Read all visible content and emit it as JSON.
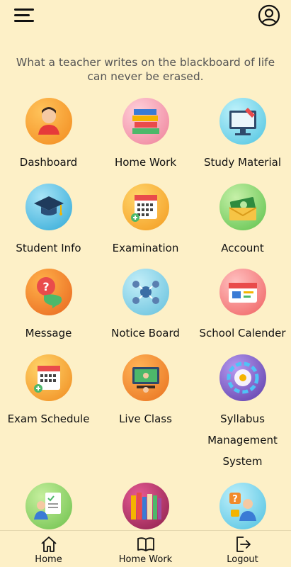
{
  "header": {
    "menu_icon": "hamburger-menu-icon",
    "profile_icon": "user-profile-icon"
  },
  "quote": "What a teacher writes on the blackboard of life can never be erased.",
  "tiles": [
    {
      "label": "Dashboard",
      "icon": "dashboard-icon",
      "color": "#f59e2b"
    },
    {
      "label": "Home Work",
      "icon": "home-work-icon",
      "color": "#f5a0b0"
    },
    {
      "label": "Study Material",
      "icon": "study-material-icon",
      "color": "#6fd3e8"
    },
    {
      "label": "Student Info",
      "icon": "student-info-icon",
      "color": "#3fb7e0"
    },
    {
      "label": "Examination",
      "icon": "examination-icon",
      "color": "#f7a633"
    },
    {
      "label": "Account",
      "icon": "account-icon",
      "color": "#86d96b"
    },
    {
      "label": "Message",
      "icon": "message-icon",
      "color": "#f07e2a"
    },
    {
      "label": "Notice Board",
      "icon": "notice-board-icon",
      "color": "#7fd2ea"
    },
    {
      "label": "School Calender",
      "icon": "school-calender-icon",
      "color": "#f46b6b"
    },
    {
      "label": "Exam Schedule",
      "icon": "exam-schedule-icon",
      "color": "#f59a2b"
    },
    {
      "label": "Live Class",
      "icon": "live-class-icon",
      "color": "#f28b2b"
    },
    {
      "label": "Syllabus Management System",
      "label_lines": [
        "Syllabus",
        "Management",
        "System"
      ],
      "icon": "syllabus-icon",
      "color": "#7a5bc6"
    },
    {
      "label": "",
      "icon": "teacher-checklist-icon",
      "color": "#8ed36e"
    },
    {
      "label": "",
      "icon": "library-books-icon",
      "color": "#b8336a"
    },
    {
      "label": "",
      "icon": "question-help-icon",
      "color": "#6dcfe8"
    }
  ],
  "bottom_nav": [
    {
      "label": "Home",
      "icon": "home-icon"
    },
    {
      "label": "Home Work",
      "icon": "book-icon"
    },
    {
      "label": "Logout",
      "icon": "logout-icon"
    }
  ]
}
